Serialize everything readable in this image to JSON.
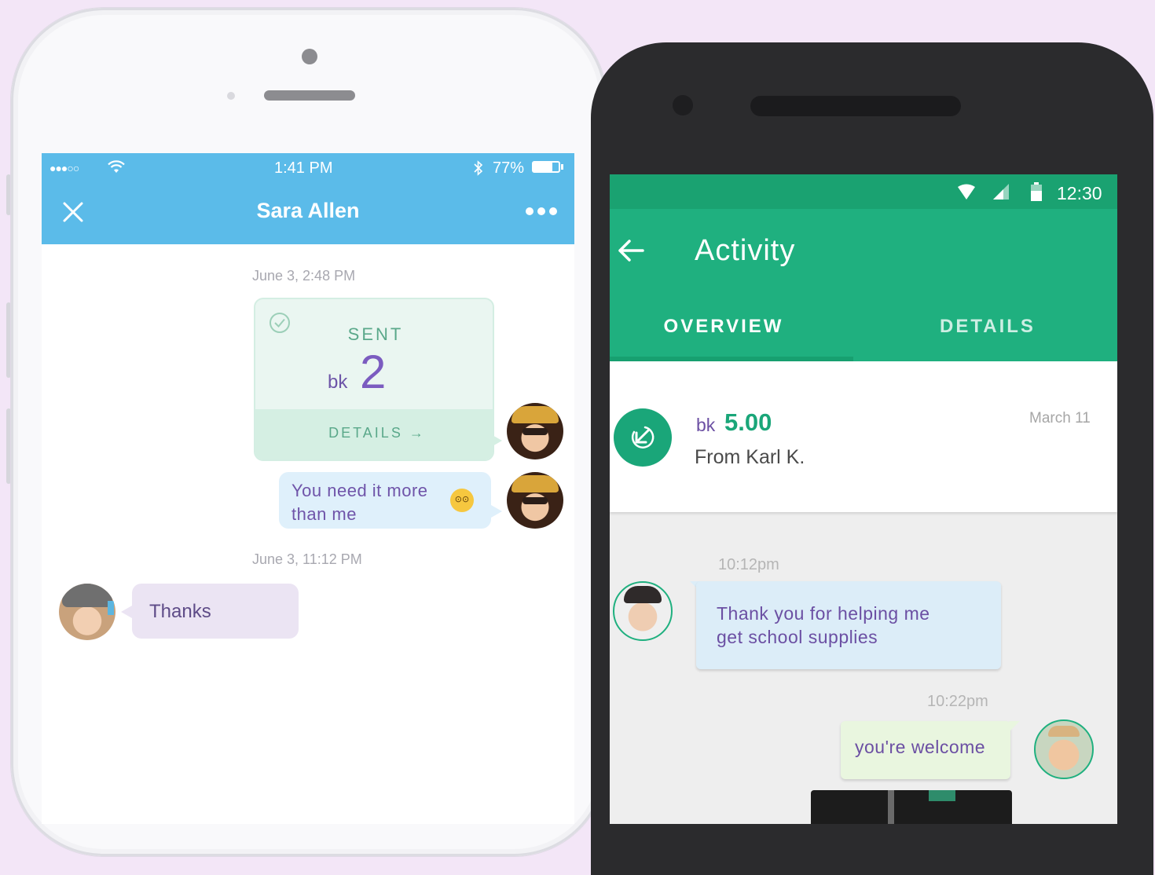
{
  "background_color": "#f3e6f7",
  "ios": {
    "status": {
      "signal": "●●●○○",
      "time": "1:41 PM",
      "battery": "77%"
    },
    "header": {
      "close_icon": "close-icon",
      "title": "Sara Allen",
      "more_icon": "more-dots-icon"
    },
    "messages": {
      "timestamp_1": "June 3, 2:48 PM",
      "sent_card": {
        "status": "SENT",
        "currency": "bk",
        "amount": "2",
        "details_label": "DETAILS →"
      },
      "bubble_1_line1": "You need it more",
      "bubble_1_line2": "than me",
      "bubble_1_emoji": "😳",
      "timestamp_2": "June 3, 11:12 PM",
      "reply": "Thanks"
    },
    "colors": {
      "header": "#5bbbe9",
      "sent_text": "#5aa88a",
      "amount": "#7b5cc0"
    }
  },
  "android": {
    "status": {
      "time": "12:30"
    },
    "appbar": {
      "title": "Activity"
    },
    "tabs": [
      {
        "label": "OVERVIEW",
        "selected": true
      },
      {
        "label": "DETAILS",
        "selected": false
      }
    ],
    "transaction": {
      "currency": "bk",
      "amount": "5.00",
      "from": "From Karl K.",
      "date": "March 11"
    },
    "chat": {
      "time_1": "10:12pm",
      "msg_1_line1": "Thank you for helping me",
      "msg_1_line2": "get school supplies",
      "time_2": "10:22pm",
      "msg_2": "you're welcome"
    },
    "colors": {
      "status_bar": "#1aa271",
      "appbar": "#1fb07f",
      "accent": "#1aa679"
    }
  }
}
